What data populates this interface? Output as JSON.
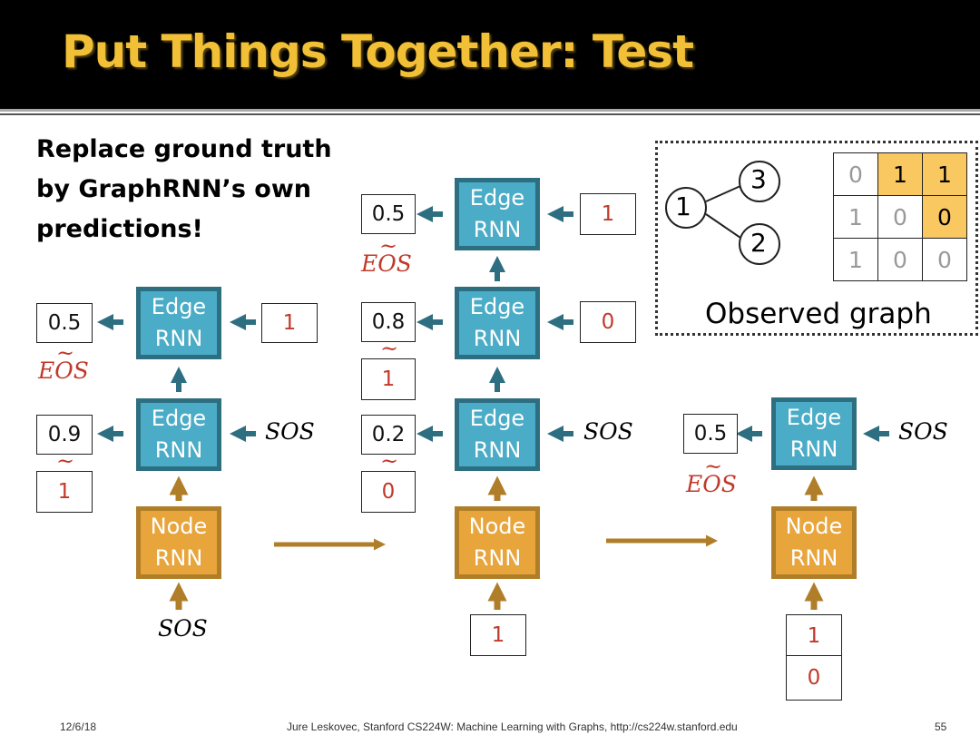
{
  "slide": {
    "title": "Put Things Together: Test",
    "subtitle": [
      "Replace ground truth",
      "by GraphRNN’s own",
      "predictions!"
    ]
  },
  "labels": {
    "edge_rnn": [
      "Edge",
      "RNN"
    ],
    "node_rnn": [
      "Node",
      "RNN"
    ],
    "sos": "SOS",
    "eos": "EOS",
    "tilde": "~"
  },
  "step1": {
    "edge_top_in": "1",
    "edge_top_out": "0.5",
    "edge_bottom_out": "0.9",
    "edge_bottom_sample": "1"
  },
  "step2": {
    "edge_top_in": "1",
    "edge_top_out": "0.5",
    "edge_mid_in": "0",
    "edge_mid_out": "0.8",
    "edge_mid_sample": "1",
    "edge_bottom_out": "0.2",
    "edge_bottom_sample": "0",
    "node_in": "1"
  },
  "step3": {
    "edge_out": "0.5",
    "node_in": [
      "1",
      "0"
    ]
  },
  "observed_graph": {
    "label": "Observed graph",
    "nodes": [
      "1",
      "2",
      "3"
    ],
    "matrix": [
      [
        "0",
        "1",
        "1"
      ],
      [
        "1",
        "0",
        "0"
      ],
      [
        "1",
        "0",
        "0"
      ]
    ],
    "highlight_color": "#F9C860"
  },
  "colors": {
    "edge_fill": "#4AACC6",
    "edge_border": "#2D6E80",
    "node_fill": "#E8A53C",
    "node_border": "#B07E28",
    "title": "#F2C037",
    "sample_text": "#C0392B"
  },
  "footer": {
    "date": "12/6/18",
    "credit": "Jure Leskovec, Stanford CS224W: Machine Learning with Graphs, http://cs224w.stanford.edu",
    "page": "55"
  }
}
